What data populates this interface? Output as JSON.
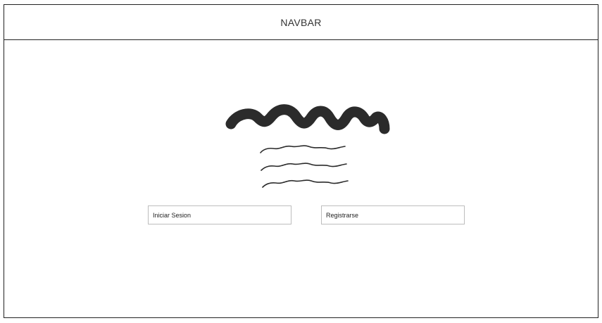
{
  "navbar": {
    "label": "NAVBAR"
  },
  "logo": {
    "icon": "scribble-logo-icon",
    "color": "#2b2b2b"
  },
  "description": {
    "icon": "scribble-text-icon",
    "line_count": 3
  },
  "actions": {
    "login_label": "Iniciar Sesion",
    "register_label": "Registrarse"
  }
}
